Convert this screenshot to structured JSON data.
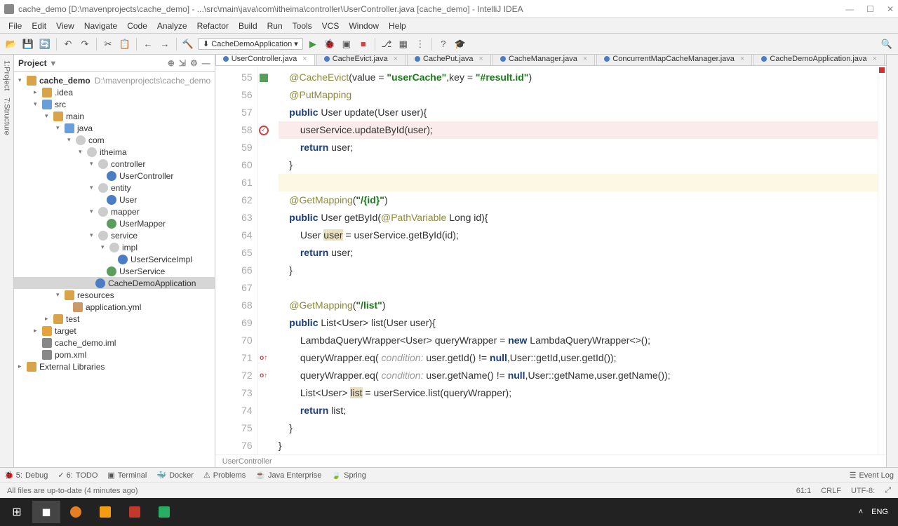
{
  "title": "cache_demo [D:\\mavenprojects\\cache_demo] - ...\\src\\main\\java\\com\\itheima\\controller\\UserController.java [cache_demo] - IntelliJ IDEA",
  "menus": [
    "File",
    "Edit",
    "View",
    "Navigate",
    "Code",
    "Analyze",
    "Refactor",
    "Build",
    "Run",
    "Tools",
    "VCS",
    "Window",
    "Help"
  ],
  "runConfig": "CacheDemoApplication",
  "projectPanel": {
    "title": "Project"
  },
  "tree": {
    "root": "cache_demo",
    "rootHint": "D:\\mavenprojects\\cache_demo",
    "idea": ".idea",
    "src": "src",
    "main": "main",
    "java": "java",
    "com": "com",
    "itheima": "itheima",
    "controller": "controller",
    "userController": "UserController",
    "entity": "entity",
    "user": "User",
    "mapper": "mapper",
    "userMapper": "UserMapper",
    "service": "service",
    "impl": "impl",
    "userServiceImpl": "UserServiceImpl",
    "userService": "UserService",
    "cacheDemoApp": "CacheDemoApplication",
    "resources": "resources",
    "appYml": "application.yml",
    "test": "test",
    "target": "target",
    "iml": "cache_demo.iml",
    "pom": "pom.xml",
    "extLib": "External Libraries"
  },
  "tabs": [
    "UserController.java",
    "CacheEvict.java",
    "CachePut.java",
    "CacheManager.java",
    "ConcurrentMapCacheManager.java",
    "CacheDemoApplication.java"
  ],
  "lineStart": 55,
  "code": {
    "l55": {
      "a": "@CacheEvict",
      "b": "(value = ",
      "s1": "\"userCache\"",
      "c": ",key = ",
      "s2": "\"#result.id\"",
      "d": ")"
    },
    "l56": {
      "a": "@PutMapping"
    },
    "l57": {
      "a": "public",
      "b": " User update(User user){"
    },
    "l58": {
      "a": "userService.updateById(user);"
    },
    "l59": {
      "a": "return",
      "b": " user;"
    },
    "l60": {
      "a": "}"
    },
    "l62a": "@GetMapping",
    "l62b": "(",
    "l62s": "\"/{id}\"",
    "l62c": ")",
    "l63": {
      "a": "public",
      "b": " User getById(",
      "c": "@PathVariable",
      "d": " Long id){"
    },
    "l64": {
      "a": "User ",
      "v": "user",
      "b": " = userService.getById(id);"
    },
    "l65": {
      "a": "return",
      "b": " user;"
    },
    "l66": {
      "a": "}"
    },
    "l68a": "@GetMapping",
    "l68b": "(",
    "l68s": "\"/list\"",
    "l68c": ")",
    "l69": {
      "a": "public",
      "b": " List<User> list(User user){"
    },
    "l70": {
      "a": "LambdaQueryWrapper<User> queryWrapper = ",
      "n": "new",
      "b": " LambdaQueryWrapper<>();"
    },
    "l71": {
      "a": "queryWrapper.eq(",
      "c": " condition:",
      "b": " user.getId() != ",
      "n": "null",
      "d": ",User::getId,user.getId());"
    },
    "l72": {
      "a": "queryWrapper.eq(",
      "c": " condition:",
      "b": " user.getName() != ",
      "n": "null",
      "d": ",User::getName,user.getName());"
    },
    "l73": {
      "a": "List<User> ",
      "v": "list",
      "b": " = userService.list(queryWrapper);"
    },
    "l74": {
      "a": "return",
      "b": " list;"
    },
    "l75": {
      "a": "}"
    },
    "l76": {
      "a": "}"
    }
  },
  "breadcrumb": "UserController",
  "bottom": {
    "debug": "Debug",
    "todo": "TODO",
    "terminal": "Terminal",
    "docker": "Docker",
    "problems": "Problems",
    "javaee": "Java Enterprise",
    "spring": "Spring",
    "eventlog": "Event Log"
  },
  "status": {
    "msg": "All files are up-to-date (4 minutes ago)",
    "pos": "61:1",
    "le": "CRLF",
    "enc": "UTF-8:",
    "lock": "⤢"
  },
  "tray": {
    "lang": "ENG",
    "other": "⌃ ⬜ ⏏"
  }
}
